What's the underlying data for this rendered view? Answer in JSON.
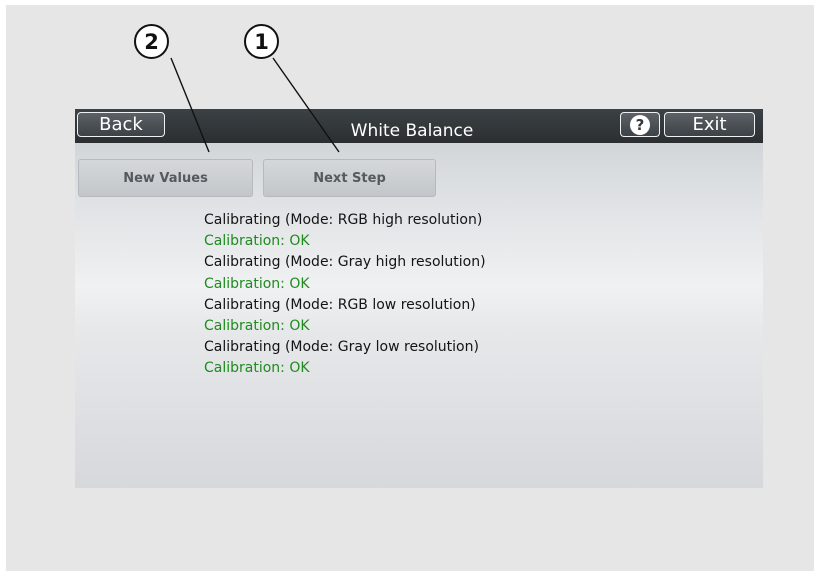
{
  "callouts": {
    "first": "1",
    "second": "2"
  },
  "header": {
    "back_label": "Back",
    "title": "White Balance",
    "help_label": "?",
    "exit_label": "Exit"
  },
  "actions": {
    "new_values_label": "New Values",
    "next_step_label": "Next Step"
  },
  "log": [
    {
      "text": "Calibrating (Mode: RGB high resolution)",
      "kind": "calibrating"
    },
    {
      "text": "Calibration: OK",
      "kind": "ok"
    },
    {
      "text": "Calibrating (Mode: Gray high resolution)",
      "kind": "calibrating"
    },
    {
      "text": "Calibration: OK",
      "kind": "ok"
    },
    {
      "text": "Calibrating (Mode: RGB low resolution)",
      "kind": "calibrating"
    },
    {
      "text": "Calibration: OK",
      "kind": "ok"
    },
    {
      "text": "Calibrating (Mode: Gray low resolution)",
      "kind": "calibrating"
    },
    {
      "text": "Calibration: OK",
      "kind": "ok"
    }
  ],
  "colors": {
    "ok_text": "#1f8b1f",
    "titlebar": "#2b2f32",
    "button_face": "#c8cccf"
  },
  "icons": {
    "help": "help-icon"
  }
}
